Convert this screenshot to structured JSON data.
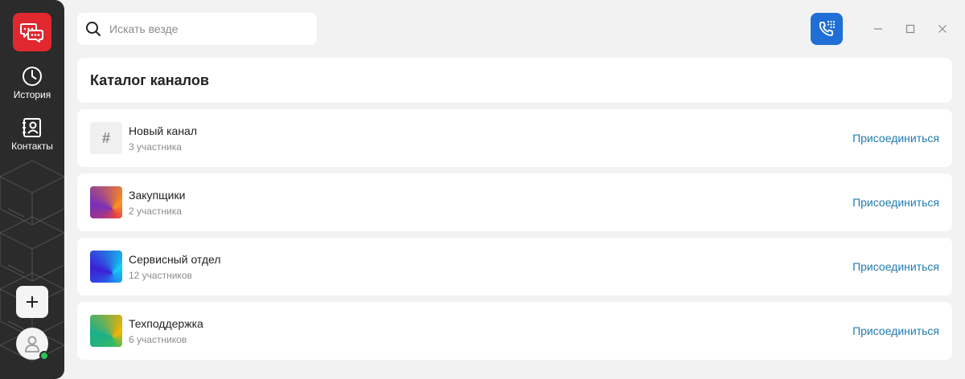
{
  "app": {
    "logo_icon": "chat-bubbles-icon",
    "brand_color": "#e0282e"
  },
  "sidebar": {
    "items": [
      {
        "label": "История",
        "icon": "clock-icon"
      },
      {
        "label": "Контакты",
        "icon": "contacts-book-icon"
      }
    ],
    "add_icon": "plus-icon",
    "avatar_icon": "user-icon",
    "status": "online",
    "status_color": "#2ec15a"
  },
  "search": {
    "placeholder": "Искать везде",
    "value": ""
  },
  "toolbar": {
    "dialer_icon": "phone-keypad-icon",
    "accent": "#1f6fd6"
  },
  "window_controls": [
    "minimize-icon",
    "maximize-icon",
    "close-icon"
  ],
  "catalog": {
    "title": "Каталог каналов",
    "join_label": "Присоединиться",
    "channels": [
      {
        "icon": "#",
        "name": "Новый канал",
        "members": "3 участника"
      },
      {
        "icon": "",
        "name": "Закупщики",
        "members": "2 участника"
      },
      {
        "icon": "",
        "name": "Сервисный отдел",
        "members": "12 участников"
      },
      {
        "icon": "",
        "name": "Техподдержка",
        "members": "6 участников"
      }
    ]
  }
}
